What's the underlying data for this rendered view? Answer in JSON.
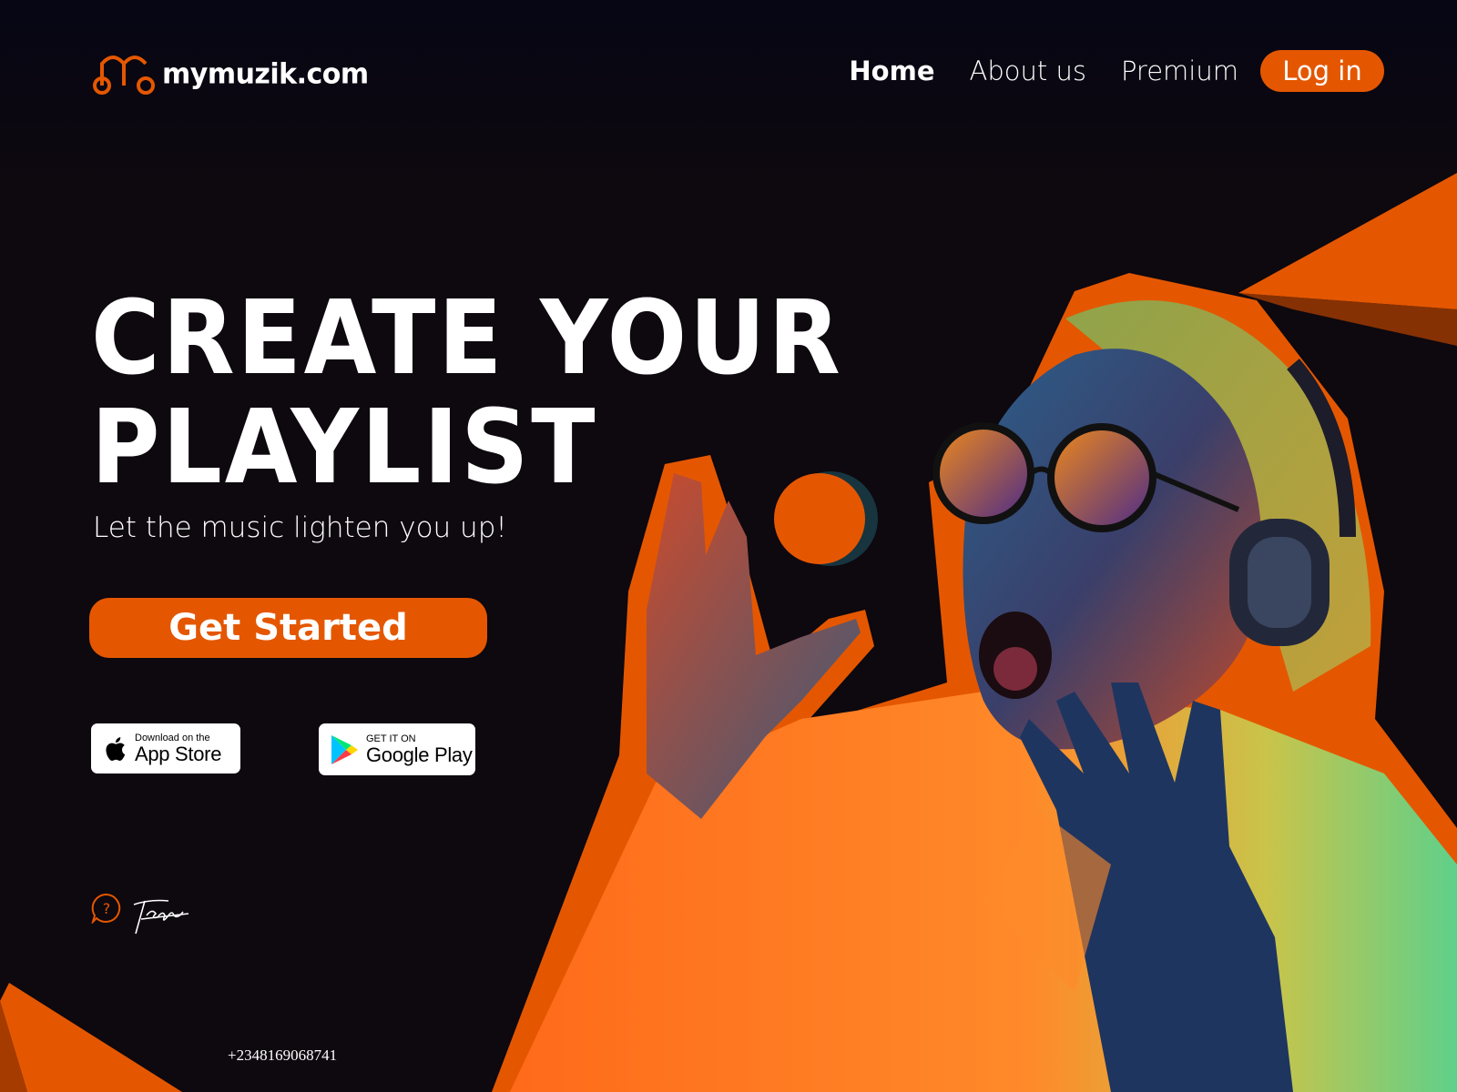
{
  "header": {
    "logo_text": "mymuzik.com",
    "nav": {
      "home": "Home",
      "about": "About us",
      "premium": "Premium",
      "login": "Log in"
    }
  },
  "hero": {
    "headline_line1": "CREATE YOUR",
    "headline_line2": "PLAYLIST",
    "subtitle": "Let the music lighten you up!",
    "cta": "Get Started"
  },
  "stores": {
    "apple_small": "Download on the",
    "apple_big": "App Store",
    "google_small": "GET IT ON",
    "google_big": "Google Play"
  },
  "footer": {
    "phone": "+2348169068741",
    "signature": "Tega"
  },
  "icons": {
    "logo": "music-note-headphones-logo-icon",
    "help": "question-chat-icon",
    "apple": "apple-icon",
    "google_play": "google-play-icon"
  },
  "colors": {
    "background": "#0e080f",
    "accent": "#e45700",
    "text": "#ffffff"
  }
}
